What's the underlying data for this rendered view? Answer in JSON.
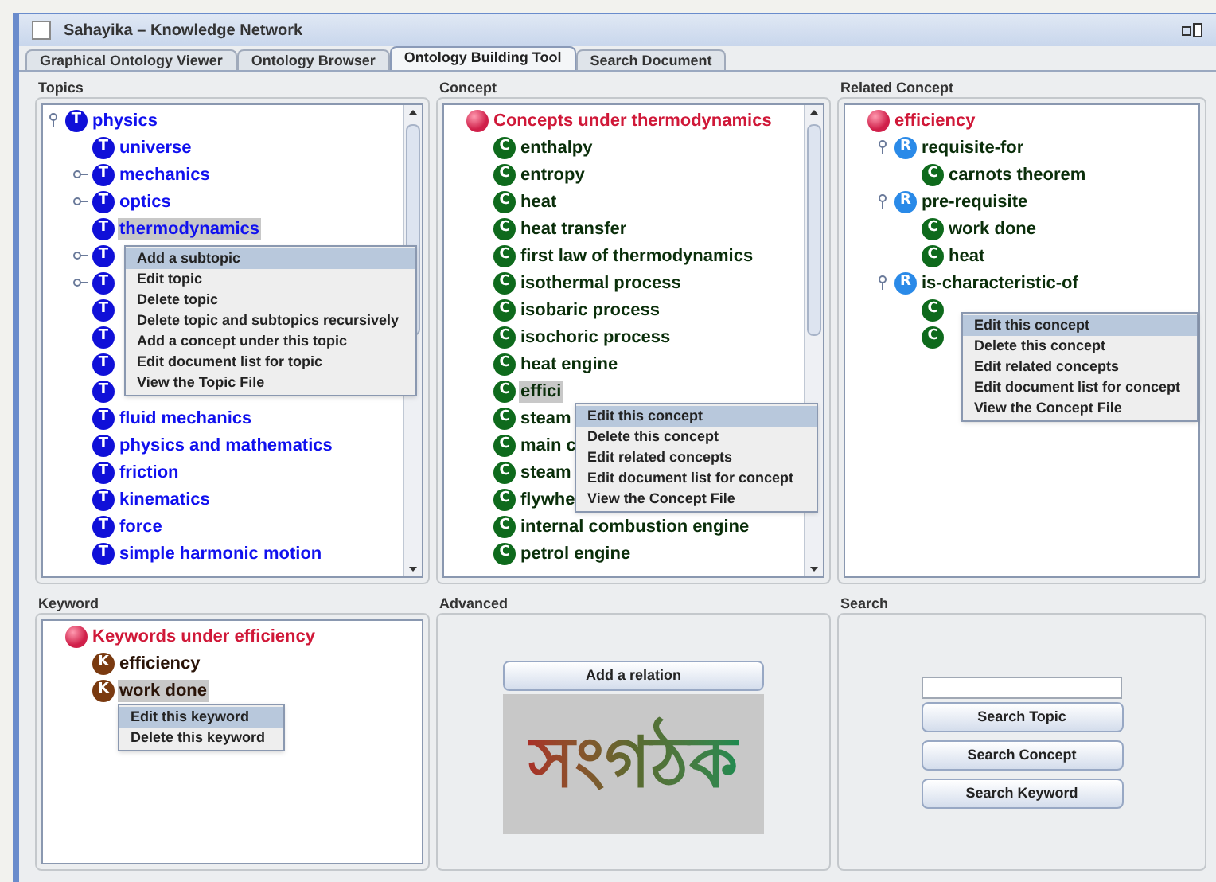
{
  "window": {
    "title": "Sahayika – Knowledge Network"
  },
  "tabs": [
    {
      "label": "Graphical Ontology Viewer",
      "selected": false
    },
    {
      "label": "Ontology Browser",
      "selected": false
    },
    {
      "label": "Ontology Building Tool",
      "selected": true
    },
    {
      "label": "Search Document",
      "selected": false
    }
  ],
  "panels": [
    {
      "title": "Topics",
      "kind": "tree",
      "scrollable": true,
      "tree": [
        {
          "kind": "topic",
          "badge": "T",
          "label": "physics",
          "expanded": true,
          "children": [
            {
              "kind": "topic",
              "badge": "T",
              "label": "universe"
            },
            {
              "kind": "topic",
              "badge": "T",
              "label": "mechanics",
              "expanded": false
            },
            {
              "kind": "topic",
              "badge": "T",
              "label": "optics",
              "expanded": false
            },
            {
              "kind": "topic",
              "badge": "T",
              "label": "thermodynamics",
              "selected": true
            },
            {
              "kind": "topic",
              "badge": "T",
              "expanded": false
            },
            {
              "kind": "topic",
              "badge": "T",
              "expanded": false
            },
            {
              "kind": "topic",
              "badge": "T"
            },
            {
              "kind": "topic",
              "badge": "T"
            },
            {
              "kind": "topic",
              "badge": "T"
            },
            {
              "kind": "topic",
              "badge": "T"
            },
            {
              "kind": "topic",
              "badge": "T",
              "label": "fluid mechanics"
            },
            {
              "kind": "topic",
              "badge": "T",
              "label": "physics and mathematics"
            },
            {
              "kind": "topic",
              "badge": "T",
              "label": "friction"
            },
            {
              "kind": "topic",
              "badge": "T",
              "label": "kinematics"
            },
            {
              "kind": "topic",
              "badge": "T",
              "label": "force"
            },
            {
              "kind": "topic",
              "badge": "T",
              "label": "simple harmonic motion"
            }
          ]
        }
      ],
      "context_menu": {
        "items": [
          {
            "label": "Add a subtopic",
            "selected": true
          },
          {
            "label": "Edit topic",
            "selected": false
          },
          {
            "label": "Delete topic",
            "selected": false
          },
          {
            "label": "Delete topic and subtopics recursively",
            "selected": false
          },
          {
            "label": "Add a concept under this topic",
            "selected": false
          },
          {
            "label": "Edit document list for topic",
            "selected": false
          },
          {
            "label": "View the Topic File",
            "selected": false
          }
        ]
      }
    },
    {
      "title": "Concept",
      "kind": "tree",
      "scrollable": true,
      "tree": [
        {
          "kind": "root",
          "label": "Concepts under thermodynamics",
          "children": [
            {
              "kind": "concept",
              "badge": "C",
              "label": "enthalpy"
            },
            {
              "kind": "concept",
              "badge": "C",
              "label": "entropy"
            },
            {
              "kind": "concept",
              "badge": "C",
              "label": "heat"
            },
            {
              "kind": "concept",
              "badge": "C",
              "label": "heat transfer"
            },
            {
              "kind": "concept",
              "badge": "C",
              "label": "first law of thermodynamics"
            },
            {
              "kind": "concept",
              "badge": "C",
              "label": "isothermal process"
            },
            {
              "kind": "concept",
              "badge": "C",
              "label": "isobaric process"
            },
            {
              "kind": "concept",
              "badge": "C",
              "label": "isochoric process"
            },
            {
              "kind": "concept",
              "badge": "C",
              "label": "heat engine"
            },
            {
              "kind": "concept",
              "badge": "C",
              "label": "effici",
              "selected": true
            },
            {
              "kind": "concept",
              "badge": "C",
              "label": "steam"
            },
            {
              "kind": "concept",
              "badge": "C",
              "label": "main c"
            },
            {
              "kind": "concept",
              "badge": "C",
              "label": "steam"
            },
            {
              "kind": "concept",
              "badge": "C",
              "label": "flywhe"
            },
            {
              "kind": "concept",
              "badge": "C",
              "label": "internal combustion engine"
            },
            {
              "kind": "concept",
              "badge": "C",
              "label": "petrol engine"
            }
          ]
        }
      ],
      "context_menu": {
        "items": [
          {
            "label": "Edit this concept",
            "selected": true
          },
          {
            "label": "Delete this concept",
            "selected": false
          },
          {
            "label": "Edit related concepts",
            "selected": false
          },
          {
            "label": "Edit document list  for concept",
            "selected": false
          },
          {
            "label": "View the Concept File",
            "selected": false
          }
        ]
      }
    },
    {
      "title": "Related Concept",
      "kind": "tree",
      "scrollable": false,
      "tree": [
        {
          "kind": "root",
          "label": "efficiency",
          "children": [
            {
              "kind": "relation",
              "badge": "R",
              "label": "requisite-for",
              "expanded": true,
              "children": [
                {
                  "kind": "concept",
                  "badge": "C",
                  "label": "carnots theorem"
                }
              ]
            },
            {
              "kind": "relation",
              "badge": "R",
              "label": "pre-requisite",
              "expanded": true,
              "children": [
                {
                  "kind": "concept",
                  "badge": "C",
                  "label": "work done"
                },
                {
                  "kind": "concept",
                  "badge": "C",
                  "label": "heat"
                }
              ]
            },
            {
              "kind": "relation",
              "badge": "R",
              "label": "is-characteristic-of",
              "expanded": true,
              "children": [
                {
                  "kind": "concept",
                  "badge": "C"
                },
                {
                  "kind": "concept",
                  "badge": "C"
                }
              ]
            }
          ]
        }
      ],
      "context_menu": {
        "items": [
          {
            "label": "Edit this concept",
            "selected": true
          },
          {
            "label": "Delete this concept",
            "selected": false
          },
          {
            "label": "Edit related concepts",
            "selected": false
          },
          {
            "label": "Edit document list  for concept",
            "selected": false
          },
          {
            "label": "View the Concept File",
            "selected": false
          }
        ]
      }
    },
    {
      "title": "Keyword",
      "kind": "tree",
      "scrollable": false,
      "tree": [
        {
          "kind": "root",
          "label": "Keywords under efficiency",
          "children": [
            {
              "kind": "keyword",
              "badge": "K",
              "label": "efficiency"
            },
            {
              "kind": "keyword",
              "badge": "K",
              "label": "work done",
              "selected": true
            }
          ]
        }
      ],
      "context_menu": {
        "items": [
          {
            "label": "Edit this keyword",
            "selected": true
          },
          {
            "label": "Delete this keyword",
            "selected": false
          }
        ]
      }
    },
    {
      "title": "Advanced",
      "kind": "advanced",
      "button": "Add a relation",
      "logo": "সংগঠক"
    },
    {
      "title": "Search",
      "kind": "search",
      "buttons": [
        "Search Topic",
        "Search Concept",
        "Search Keyword"
      ]
    }
  ]
}
